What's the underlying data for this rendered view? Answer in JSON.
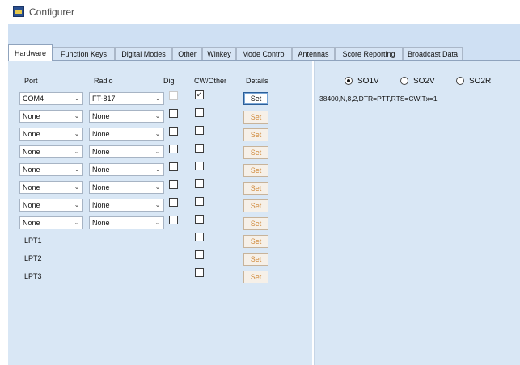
{
  "window": {
    "title": "Configurer"
  },
  "tabs": [
    {
      "label": "Hardware",
      "active": true
    },
    {
      "label": "Function Keys",
      "active": false
    },
    {
      "label": "Digital Modes",
      "active": false
    },
    {
      "label": "Other",
      "active": false
    },
    {
      "label": "Winkey",
      "active": false
    },
    {
      "label": "Mode Control",
      "active": false
    },
    {
      "label": "Antennas",
      "active": false
    },
    {
      "label": "Score Reporting",
      "active": false
    },
    {
      "label": "Broadcast Data",
      "active": false
    }
  ],
  "columns": {
    "port": "Port",
    "radio": "Radio",
    "digi": "Digi",
    "cw": "CW/Other",
    "details": "Details"
  },
  "rows": [
    {
      "port": "COM4",
      "radio": "FT-817",
      "digi": false,
      "cw": true,
      "set": "Set"
    },
    {
      "port": "None",
      "radio": "None",
      "digi": false,
      "cw": false,
      "set": "Set"
    },
    {
      "port": "None",
      "radio": "None",
      "digi": false,
      "cw": false,
      "set": "Set"
    },
    {
      "port": "None",
      "radio": "None",
      "digi": false,
      "cw": false,
      "set": "Set"
    },
    {
      "port": "None",
      "radio": "None",
      "digi": false,
      "cw": false,
      "set": "Set"
    },
    {
      "port": "None",
      "radio": "None",
      "digi": false,
      "cw": false,
      "set": "Set"
    },
    {
      "port": "None",
      "radio": "None",
      "digi": false,
      "cw": false,
      "set": "Set"
    },
    {
      "port": "None",
      "radio": "None",
      "digi": false,
      "cw": false,
      "set": "Set"
    }
  ],
  "lpt_rows": [
    {
      "label": "LPT1",
      "cw": false,
      "set": "Set"
    },
    {
      "label": "LPT2",
      "cw": false,
      "set": "Set"
    },
    {
      "label": "LPT3",
      "cw": false,
      "set": "Set"
    }
  ],
  "so_modes": [
    {
      "label": "SO1V",
      "selected": true
    },
    {
      "label": "SO2V",
      "selected": false
    },
    {
      "label": "SO2R",
      "selected": false
    }
  ],
  "port_settings": "38400,N,8,2,DTR=PTT,RTS=CW,Tx=1",
  "icons": {
    "dropdown": "chevron-down-icon",
    "check": "checkmark-icon",
    "app": "app-logo-icon"
  }
}
